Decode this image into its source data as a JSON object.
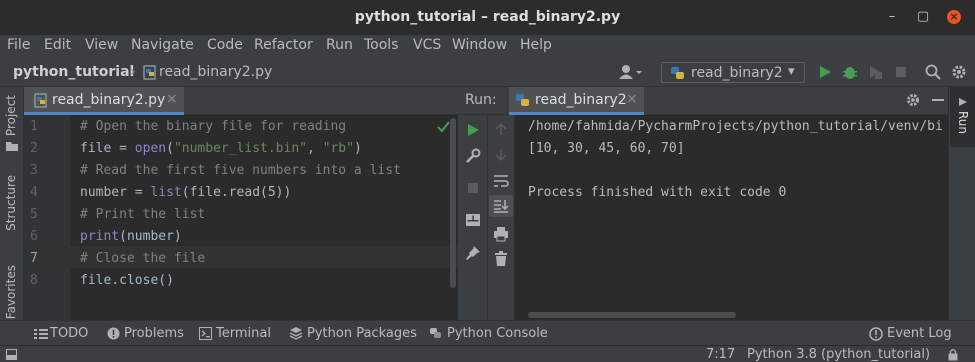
{
  "window": {
    "title": "python_tutorial – read_binary2.py",
    "minimize": "–",
    "maximize": "▢",
    "close": "×"
  },
  "menu": [
    "File",
    "Edit",
    "View",
    "Navigate",
    "Code",
    "Refactor",
    "Run",
    "Tools",
    "VCS",
    "Window",
    "Help"
  ],
  "breadcrumb": {
    "project": "python_tutorial",
    "separator": "›",
    "file": "read_binary2.py"
  },
  "run_config": {
    "name": "read_binary2",
    "arrow": "▾"
  },
  "left_strip": {
    "project": "Project",
    "structure": "Structure",
    "favorites": "Favorites"
  },
  "editor": {
    "tab_label": "read_binary2.py",
    "tab_close": "×",
    "line_numbers": [
      "1",
      "2",
      "3",
      "4",
      "5",
      "6",
      "7",
      "8"
    ],
    "current_line": 7
  },
  "code": {
    "l1": "# Open the binary file for reading",
    "l2_var": "file = ",
    "l2_fn": "open",
    "l2_p1": "(",
    "l2_s1": "\"number_list.bin\"",
    "l2_p2": ", ",
    "l2_s2": "\"rb\"",
    "l2_p3": ")",
    "l3": "# Read the first five numbers into a list",
    "l4_var": "number = ",
    "l4_fn": "list",
    "l4_rest": "(file.read(5))",
    "l5": "# Print the list",
    "l6_fn": "print",
    "l6_rest": "(number)",
    "l7": "# Close the file",
    "l8": "file.close()"
  },
  "run": {
    "label": "Run:",
    "tab_label": "read_binary2",
    "tab_close": "×",
    "strip_label": "Run",
    "output": [
      "/home/fahmida/PycharmProjects/python_tutorial/venv/bi",
      "[10, 30, 45, 60, 70]",
      "",
      "Process finished with exit code 0"
    ]
  },
  "bottom_tabs": [
    "TODO",
    "Problems",
    "Terminal",
    "Python Packages",
    "Python Console"
  ],
  "event_log": "Event Log",
  "status": {
    "position": "7:17",
    "interpreter": "Python 3.8 (python_tutorial)"
  },
  "colors": {
    "accent": "#4a88c7",
    "run_green": "#499c54",
    "comment": "#808080",
    "string": "#6a8759",
    "builtin": "#8888c6"
  },
  "icons": [
    "folder-icon",
    "python-file-icon",
    "user-icon",
    "run-icon",
    "debug-icon",
    "coverage-icon",
    "stop-icon",
    "search-icon",
    "settings-icon",
    "wrench-icon",
    "layout-icon",
    "pin-icon",
    "scroll-up-icon",
    "scroll-down-icon",
    "wrap-icon",
    "scroll-to-end-icon",
    "print-icon",
    "trash-icon",
    "todo-icon",
    "problems-icon",
    "terminal-icon",
    "packages-icon",
    "console-icon",
    "event-log-icon",
    "lock-icon",
    "checkmark-icon"
  ]
}
